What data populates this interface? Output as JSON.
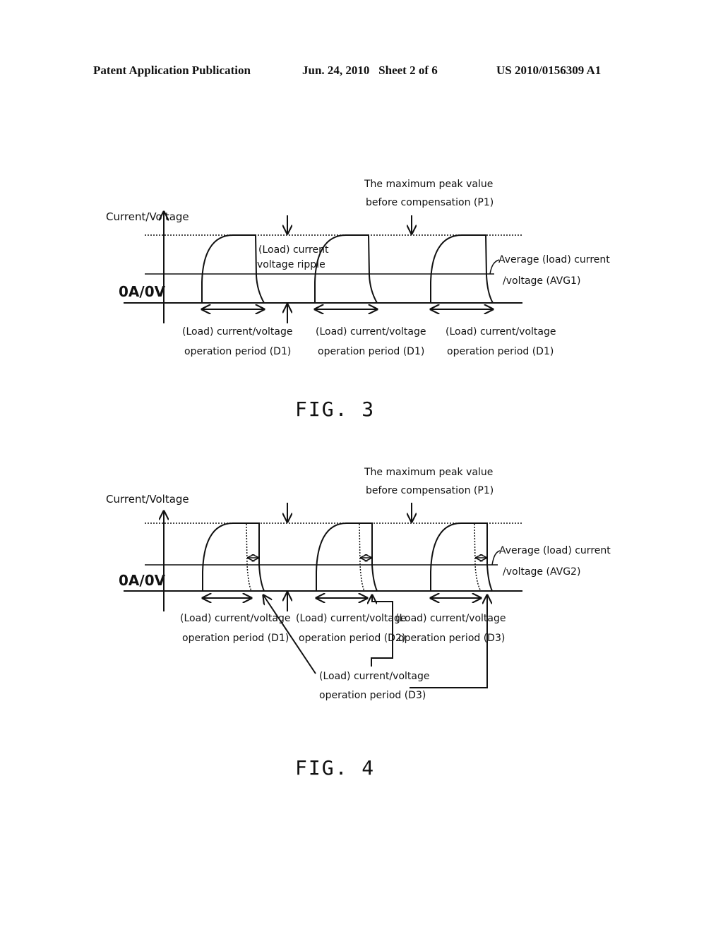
{
  "header": {
    "publication": "Patent Application Publication",
    "date_sheet": "Jun. 24, 2010   Sheet 2 of 6",
    "number": "US 2010/0156309 A1"
  },
  "fig3": {
    "caption": "FIG. 3",
    "y_axis_label": "Current/Voltage",
    "zero_label": "0A/0V",
    "peak_label_line1": "The maximum peak value",
    "peak_label_line2": "before compensation (P1)",
    "ripple_label_line1": "(Load) current",
    "ripple_label_line2": "voltage ripple",
    "avg_label_line1": "Average (load) current",
    "avg_label_line2": "/voltage (AVG1)",
    "periods": [
      {
        "line1": "(Load) current/voltage",
        "line2": "operation period (D1)"
      },
      {
        "line1": "(Load) current/voltage",
        "line2": "operation period (D1)"
      },
      {
        "line1": "(Load) current/voltage",
        "line2": "operation period (D1)"
      }
    ]
  },
  "fig4": {
    "caption": "FIG. 4",
    "y_axis_label": "Current/Voltage",
    "zero_label": "0A/0V",
    "peak_label_line1": "The maximum peak value",
    "peak_label_line2": "before compensation (P1)",
    "avg_label_line1": "Average (load) current",
    "avg_label_line2": "/voltage (AVG2)",
    "periods": [
      {
        "line1": "(Load) current/voltage",
        "line2": "operation period (D1)"
      },
      {
        "line1": "(Load) current/voltage",
        "line2": "operation period (D2)"
      },
      {
        "line1": "(Load) current/voltage",
        "line2": "operation period (D3)"
      }
    ],
    "callout": {
      "line1": "(Load) current/voltage",
      "line2": "operation period (D3)"
    }
  }
}
